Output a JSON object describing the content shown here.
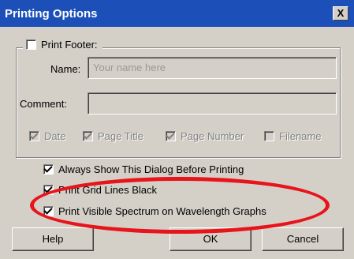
{
  "window": {
    "title": "Printing Options",
    "close_label": "X"
  },
  "footer_group": {
    "print_footer_label": "Print Footer:",
    "print_footer_checked": false,
    "name_label": "Name:",
    "name_value": "",
    "name_placeholder": "Your name here",
    "comment_label": "Comment:",
    "comment_value": "",
    "options": [
      {
        "label": "Date",
        "checked": true
      },
      {
        "label": "Page Title",
        "checked": true
      },
      {
        "label": "Page Number",
        "checked": true
      },
      {
        "label": "Filename",
        "checked": false
      }
    ]
  },
  "settings": [
    {
      "label": "Always Show This Dialog Before Printing",
      "checked": true
    },
    {
      "label": "Print Grid Lines Black",
      "checked": true
    },
    {
      "label": "Print Visible Spectrum on Wavelength Graphs",
      "checked": true
    }
  ],
  "buttons": {
    "help": "Help",
    "ok": "OK",
    "cancel": "Cancel"
  },
  "colors": {
    "title_bar": "#1c4fb8",
    "highlight_ellipse": "#e8141c",
    "dialog_bg": "#d4d0c8"
  }
}
